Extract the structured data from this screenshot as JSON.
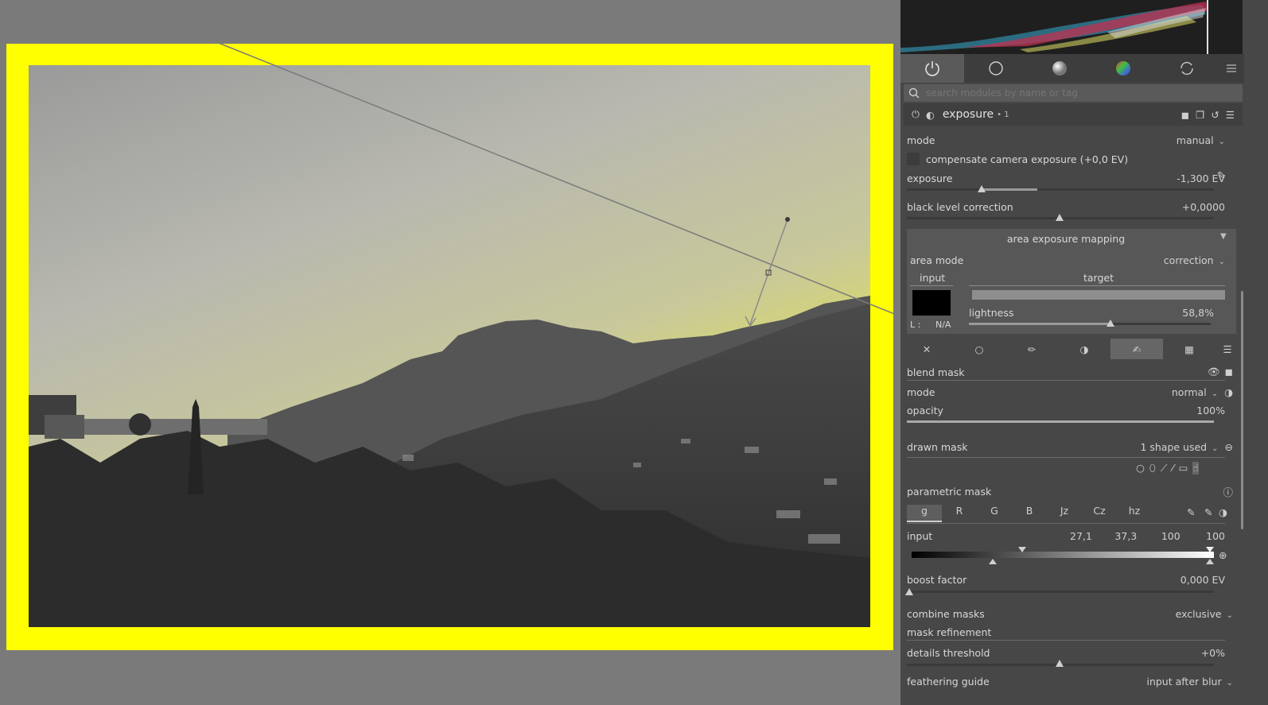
{
  "module_tabs": [
    {
      "icon": "power-icon",
      "active": true
    },
    {
      "icon": "circle-outline-icon"
    },
    {
      "icon": "gray-sphere-icon"
    },
    {
      "icon": "color-wheel-icon"
    },
    {
      "icon": "refresh-icon"
    },
    {
      "icon": "menu-icon"
    }
  ],
  "search": {
    "placeholder": "search modules by name or tag"
  },
  "module": {
    "name": "exposure",
    "instance": "• 1"
  },
  "exposure": {
    "mode_label": "mode",
    "mode_value": "manual",
    "compensate_label": "compensate camera exposure (+0,0 EV)",
    "exposure_label": "exposure",
    "exposure_value": "-1,300 EV",
    "black_label": "black level correction",
    "black_value": "+0,0000"
  },
  "area": {
    "section": "area exposure mapping",
    "mode_label": "area mode",
    "mode_value": "correction",
    "input_label": "input",
    "target_label": "target",
    "l_label": "L :",
    "l_value": "N/A",
    "lightness_label": "lightness",
    "lightness_value": "58,8%"
  },
  "blend": {
    "section": "blend mask",
    "mode_label": "mode",
    "mode_value": "normal",
    "opacity_label": "opacity",
    "opacity_value": "100%",
    "drawn_label": "drawn mask",
    "drawn_value": "1 shape used",
    "parametric_label": "parametric mask",
    "channels": [
      "g",
      "R",
      "G",
      "B",
      "Jz",
      "Cz",
      "hz"
    ],
    "input_label": "input",
    "input_values": [
      "27,1",
      "37,3",
      "100",
      "100"
    ],
    "boost_label": "boost factor",
    "boost_value": "0,000 EV",
    "combine_label": "combine masks",
    "combine_value": "exclusive",
    "refine_label": "mask refinement",
    "details_label": "details threshold",
    "details_value": "+0%",
    "feather_label": "feathering guide",
    "feather_value": "input after blur"
  },
  "colors": {
    "mask_overlay": "#ffff00",
    "panel_bg": "#474747",
    "canvas_bg": "#7a7a7a"
  }
}
